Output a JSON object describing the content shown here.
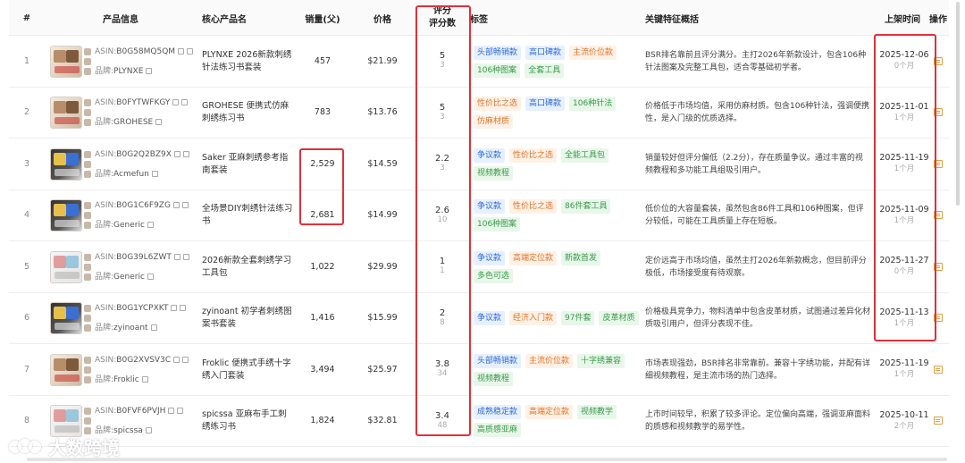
{
  "columns": {
    "index": "#",
    "product_info": "产品信息",
    "core_name": "核心产品名",
    "sales": "销量(父)",
    "price": "价格",
    "rating_line1": "评分",
    "rating_line2": "评分数",
    "tags": "标签",
    "features": "关键特征概括",
    "listed": "上架时间",
    "action": "操作"
  },
  "labels": {
    "asin": "ASIN:",
    "brand": "品牌:"
  },
  "rows": [
    {
      "index": "1",
      "asin": "B0G58MQ5QM",
      "brand": "PLYNXE",
      "name": "PLYNXE 2026新款刺绣针法练习书套装",
      "sales": "457",
      "price": "$21.99",
      "rating": "5",
      "rating_count": "3",
      "tags": [
        {
          "text": "头部畅销款",
          "color": "blue"
        },
        {
          "text": "高口碑款",
          "color": "blue"
        },
        {
          "text": "主流价位款",
          "color": "orange"
        },
        {
          "text": "106种图案",
          "color": "green"
        },
        {
          "text": "全套工具",
          "color": "green"
        }
      ],
      "feature": "BSR排名靠前且评分满分。主打2026年新款设计，包含106种针法图案及完整工具包，适合零基础初学者。",
      "date": "2025-12-06",
      "age": "0个月",
      "thumb": "warm"
    },
    {
      "index": "2",
      "asin": "B0FYTWFKGY",
      "brand": "GROHESE",
      "name": "GROHESE 便携式仿麻刺绣练习书",
      "sales": "783",
      "price": "$13.76",
      "rating": "5",
      "rating_count": "3",
      "tags": [
        {
          "text": "性价比之选",
          "color": "orange"
        },
        {
          "text": "高口碑款",
          "color": "blue"
        },
        {
          "text": "106种针法",
          "color": "green"
        },
        {
          "text": "仿麻材质",
          "color": "orange"
        }
      ],
      "feature": "价格低于市场均值，采用仿麻材质。包含106种针法，强调便携性，是入门级的优质选择。",
      "date": "2025-11-01",
      "age": "1个月",
      "thumb": "warm"
    },
    {
      "index": "3",
      "asin": "B0G2Q2BZ9X",
      "brand": "Acmefun",
      "name": "Saker 亚麻刺绣参考指南套装",
      "sales": "2,529",
      "price": "$14.59",
      "rating": "2.2",
      "rating_count": "3",
      "tags": [
        {
          "text": "争议款",
          "color": "blue"
        },
        {
          "text": "性价比之选",
          "color": "orange"
        },
        {
          "text": "全能工具包",
          "color": "green"
        },
        {
          "text": "视频教程",
          "color": "green"
        }
      ],
      "feature": "销量较好但评分偏低（2.2分），存在质量争议。通过丰富的视频教程和多功能工具组吸引用户。",
      "date": "2025-11-19",
      "age": "1个月",
      "thumb": "dark"
    },
    {
      "index": "4",
      "asin": "B0G1C6F9ZG",
      "brand": "Generic",
      "name": "全场景DIY刺绣针法练习书",
      "sales": "2,681",
      "price": "$14.99",
      "rating": "2.6",
      "rating_count": "10",
      "tags": [
        {
          "text": "争议款",
          "color": "blue"
        },
        {
          "text": "性价比之选",
          "color": "orange"
        },
        {
          "text": "86件套工具",
          "color": "green"
        },
        {
          "text": "106种图案",
          "color": "green"
        }
      ],
      "feature": "低价位的大容量套装，虽然包含86件工具和106种图案，但评分较低，可能在工具质量上存在短板。",
      "date": "2025-11-09",
      "age": "1个月",
      "thumb": "dark"
    },
    {
      "index": "5",
      "asin": "B0G39L6ZWT",
      "brand": "Generic",
      "name": "2026新款全套刺绣学习工具包",
      "sales": "1,022",
      "price": "$29.99",
      "rating": "1",
      "rating_count": "1",
      "tags": [
        {
          "text": "争议款",
          "color": "blue"
        },
        {
          "text": "高端定位款",
          "color": "orange"
        },
        {
          "text": "新款首发",
          "color": "green"
        },
        {
          "text": "多色可选",
          "color": "green"
        }
      ],
      "feature": "定价远高于市场均值，虽然主打2026年新款概念，但目前评分极低，市场接受度有待观察。",
      "date": "2025-11-27",
      "age": "0个月",
      "thumb": "light"
    },
    {
      "index": "6",
      "asin": "B0G1YCPXKT",
      "brand": "zyinoant",
      "name": "zyinoant 初学者刺绣图案书套装",
      "sales": "1,416",
      "price": "$15.99",
      "rating": "2",
      "rating_count": "8",
      "tags": [
        {
          "text": "争议款",
          "color": "blue"
        },
        {
          "text": "经济入门款",
          "color": "orange"
        },
        {
          "text": "97件套",
          "color": "green"
        },
        {
          "text": "皮革材质",
          "color": "green"
        }
      ],
      "feature": "价格极具竞争力，物料清单中包含皮革材质，试图通过差异化材质吸引用户，但评分表现不佳。",
      "date": "2025-11-13",
      "age": "1个月",
      "thumb": "dark"
    },
    {
      "index": "7",
      "asin": "B0G2XVSV3C",
      "brand": "Froklic",
      "name": "Froklic 便携式手绣十字绣入门套装",
      "sales": "3,494",
      "price": "$25.97",
      "rating": "3.8",
      "rating_count": "34",
      "tags": [
        {
          "text": "头部畅销款",
          "color": "blue"
        },
        {
          "text": "主流价位款",
          "color": "orange"
        },
        {
          "text": "十字绣兼容",
          "color": "green"
        },
        {
          "text": "视频教程",
          "color": "green"
        }
      ],
      "feature": "市场表现强劲，BSR排名非常靠前。兼容十字绣功能，并配有详细视频教程，是主流市场的热门选择。",
      "date": "2025-11-19",
      "age": "1个月",
      "thumb": "warm"
    },
    {
      "index": "8",
      "asin": "B0FVF6PVJH",
      "brand": "spicssa",
      "name": "spicssa 亚麻布手工刺绣练习书",
      "sales": "1,824",
      "price": "$32.81",
      "rating": "3.4",
      "rating_count": "48",
      "tags": [
        {
          "text": "成熟稳定款",
          "color": "blue"
        },
        {
          "text": "高端定位款",
          "color": "orange"
        },
        {
          "text": "视频教学",
          "color": "green"
        },
        {
          "text": "高质感亚麻",
          "color": "green"
        }
      ],
      "feature": "上市时间较早，积累了较多评论。定位偏向高端，强调亚麻面料的质感和视频教学的易学性。",
      "date": "2025-10-11",
      "age": "2个月",
      "thumb": "light"
    }
  ],
  "watermark": "大数跨境",
  "colors": {
    "highlight_border": "#e0303a",
    "tag_blue": "#2f6bd6",
    "tag_orange": "#e0742a",
    "tag_green": "#3a9a4a"
  }
}
